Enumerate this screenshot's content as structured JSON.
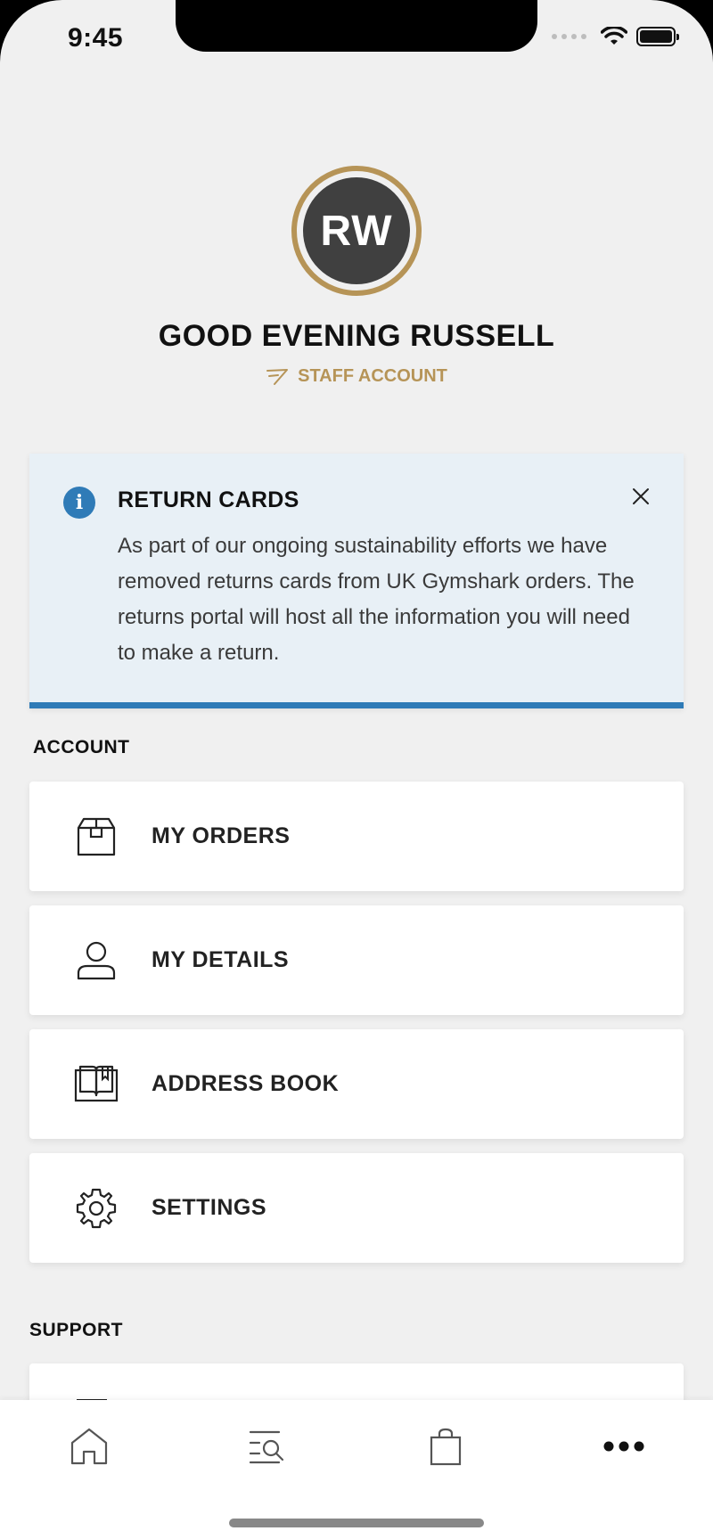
{
  "status_bar": {
    "time": "9:45"
  },
  "profile": {
    "initials": "RW",
    "greeting": "GOOD EVENING RUSSELL",
    "account_type": "STAFF ACCOUNT",
    "accent_color": "#b69457"
  },
  "banner": {
    "title": "RETURN CARDS",
    "body": "As part of our ongoing sustainability efforts we have removed returns cards from UK Gymshark orders. The returns portal will host all the information you will need to make a return.",
    "accent_color": "#2f7bb7"
  },
  "account_section": {
    "label": "ACCOUNT",
    "items": [
      {
        "label": "MY ORDERS",
        "icon": "box-icon"
      },
      {
        "label": "MY DETAILS",
        "icon": "user-icon"
      },
      {
        "label": "ADDRESS BOOK",
        "icon": "book-icon"
      },
      {
        "label": "SETTINGS",
        "icon": "gear-icon"
      }
    ]
  },
  "support_section": {
    "label": "SUPPORT"
  },
  "tab_bar": {
    "tabs": [
      {
        "icon": "home-icon"
      },
      {
        "icon": "search-list-icon"
      },
      {
        "icon": "bag-icon"
      },
      {
        "icon": "more-icon",
        "active": true
      }
    ]
  }
}
